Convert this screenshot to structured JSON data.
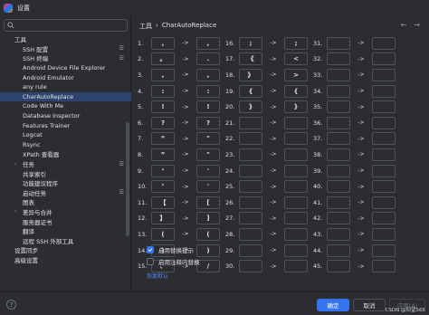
{
  "window": {
    "title": "设置"
  },
  "search": {
    "placeholder": ""
  },
  "sidebar": {
    "items": [
      {
        "label": "工具",
        "level": 0,
        "expand": false,
        "mark": false,
        "selected": false
      },
      {
        "label": "SSH 配置",
        "level": 1,
        "expand": false,
        "mark": true,
        "selected": false
      },
      {
        "label": "SSH 终端",
        "level": 1,
        "expand": false,
        "mark": true,
        "selected": false
      },
      {
        "label": "Android Device File Explorer",
        "level": 1,
        "expand": false,
        "mark": false,
        "selected": false
      },
      {
        "label": "Android Emulator",
        "level": 1,
        "expand": false,
        "mark": false,
        "selected": false
      },
      {
        "label": "any rule",
        "level": 1,
        "expand": false,
        "mark": false,
        "selected": false
      },
      {
        "label": "CharAutoReplace",
        "level": 1,
        "expand": false,
        "mark": false,
        "selected": true
      },
      {
        "label": "Code With Me",
        "level": 1,
        "expand": false,
        "mark": false,
        "selected": false
      },
      {
        "label": "Database Inspector",
        "level": 1,
        "expand": false,
        "mark": false,
        "selected": false
      },
      {
        "label": "Features Trainer",
        "level": 1,
        "expand": false,
        "mark": false,
        "selected": false
      },
      {
        "label": "Logcat",
        "level": 1,
        "expand": false,
        "mark": false,
        "selected": false
      },
      {
        "label": "Rsync",
        "level": 1,
        "expand": false,
        "mark": false,
        "selected": false
      },
      {
        "label": "XPath 查看器",
        "level": 1,
        "expand": false,
        "mark": false,
        "selected": false
      },
      {
        "label": "任务",
        "level": 1,
        "expand": true,
        "mark": true,
        "selected": false
      },
      {
        "label": "共享索引",
        "level": 1,
        "expand": false,
        "mark": false,
        "selected": false
      },
      {
        "label": "功能建议程序",
        "level": 1,
        "expand": false,
        "mark": false,
        "selected": false
      },
      {
        "label": "启动任务",
        "level": 1,
        "expand": false,
        "mark": true,
        "selected": false
      },
      {
        "label": "图表",
        "level": 1,
        "expand": false,
        "mark": false,
        "selected": false
      },
      {
        "label": "差异与合并",
        "level": 1,
        "expand": true,
        "mark": false,
        "selected": false
      },
      {
        "label": "服务器证书",
        "level": 1,
        "expand": false,
        "mark": false,
        "selected": false
      },
      {
        "label": "翻译",
        "level": 1,
        "expand": false,
        "mark": false,
        "selected": false
      },
      {
        "label": "远程 SSH 外部工具",
        "level": 1,
        "expand": false,
        "mark": false,
        "selected": false
      },
      {
        "label": "设置同步",
        "level": 0,
        "expand": false,
        "mark": false,
        "selected": false
      },
      {
        "label": "高级设置",
        "level": 0,
        "expand": false,
        "mark": false,
        "selected": false
      }
    ]
  },
  "breadcrumb": {
    "parent": "工具",
    "separator": "›",
    "current": "CharAutoReplace"
  },
  "nav": {
    "back": "←",
    "forward": "→"
  },
  "arrow_text": "->",
  "mappings": [
    [
      {
        "n": "1.",
        "from": ",",
        "to": ","
      },
      {
        "n": "16.",
        "from": ";",
        "to": ";"
      },
      {
        "n": "31.",
        "from": "",
        "to": ""
      }
    ],
    [
      {
        "n": "2.",
        "from": "。",
        "to": "."
      },
      {
        "n": "17.",
        "from": "《",
        "to": "<"
      },
      {
        "n": "32.",
        "from": "",
        "to": ""
      }
    ],
    [
      {
        "n": "3.",
        "from": ",",
        "to": ","
      },
      {
        "n": "18.",
        "from": "》",
        "to": ">"
      },
      {
        "n": "33.",
        "from": "",
        "to": ""
      }
    ],
    [
      {
        "n": "4.",
        "from": ":",
        "to": ":"
      },
      {
        "n": "19.",
        "from": "{",
        "to": "{"
      },
      {
        "n": "34.",
        "from": "",
        "to": ""
      }
    ],
    [
      {
        "n": "5.",
        "from": "!",
        "to": "!"
      },
      {
        "n": "20.",
        "from": "}",
        "to": "}"
      },
      {
        "n": "35.",
        "from": "",
        "to": ""
      }
    ],
    [
      {
        "n": "6.",
        "from": "?",
        "to": "?"
      },
      {
        "n": "21.",
        "from": "",
        "to": ""
      },
      {
        "n": "36.",
        "from": "",
        "to": ""
      }
    ],
    [
      {
        "n": "7.",
        "from": "“",
        "to": "\""
      },
      {
        "n": "22.",
        "from": "",
        "to": ""
      },
      {
        "n": "37.",
        "from": "",
        "to": ""
      }
    ],
    [
      {
        "n": "8.",
        "from": "”",
        "to": "\""
      },
      {
        "n": "23.",
        "from": "",
        "to": ""
      },
      {
        "n": "38.",
        "from": "",
        "to": ""
      }
    ],
    [
      {
        "n": "9.",
        "from": "‘",
        "to": "'"
      },
      {
        "n": "24.",
        "from": "",
        "to": ""
      },
      {
        "n": "39.",
        "from": "",
        "to": ""
      }
    ],
    [
      {
        "n": "10.",
        "from": "’",
        "to": "'"
      },
      {
        "n": "25.",
        "from": "",
        "to": ""
      },
      {
        "n": "40.",
        "from": "",
        "to": ""
      }
    ],
    [
      {
        "n": "11.",
        "from": "【",
        "to": "["
      },
      {
        "n": "26.",
        "from": "",
        "to": ""
      },
      {
        "n": "41.",
        "from": "",
        "to": ""
      }
    ],
    [
      {
        "n": "12.",
        "from": "】",
        "to": "]"
      },
      {
        "n": "27.",
        "from": "",
        "to": ""
      },
      {
        "n": "42.",
        "from": "",
        "to": ""
      }
    ],
    [
      {
        "n": "13.",
        "from": "(",
        "to": "("
      },
      {
        "n": "28.",
        "from": "",
        "to": ""
      },
      {
        "n": "43.",
        "from": "",
        "to": ""
      }
    ],
    [
      {
        "n": "14.",
        "from": ")",
        "to": ")"
      },
      {
        "n": "29.",
        "from": "",
        "to": ""
      },
      {
        "n": "44.",
        "from": "",
        "to": ""
      }
    ],
    [
      {
        "n": "15.",
        "from": "、",
        "to": "/"
      },
      {
        "n": "30.",
        "from": "",
        "to": ""
      },
      {
        "n": "45.",
        "from": "",
        "to": ""
      }
    ]
  ],
  "options": [
    {
      "label": "启用替换提示",
      "checked": true
    },
    {
      "label": "启用注释内替换",
      "checked": false
    }
  ],
  "reset_label": "恢复默认",
  "footer": {
    "help": "?",
    "ok": "确定",
    "cancel": "取消",
    "apply": "应用(A)",
    "watermark": "CSDN @仰望566"
  },
  "colors": {
    "accent": "#3574f0",
    "selected_row": "#2e436e",
    "link": "#548af7",
    "background": "#2b2d30"
  }
}
